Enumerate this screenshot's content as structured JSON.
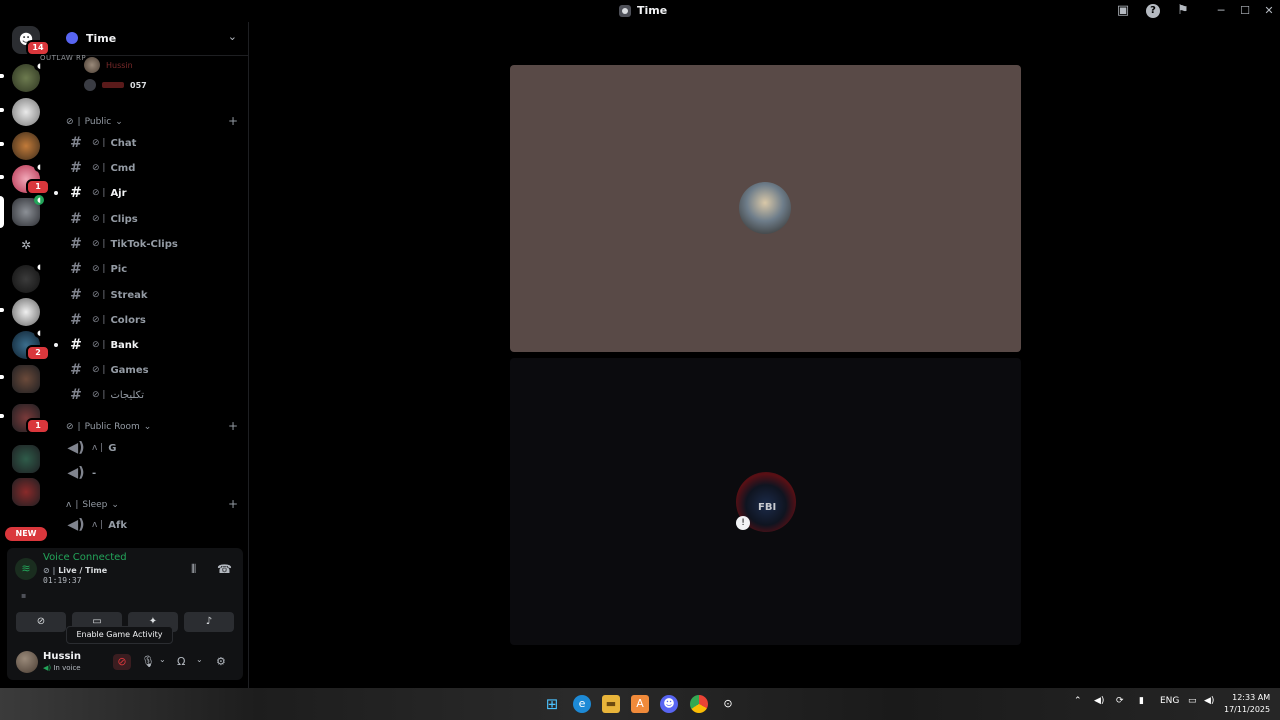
{
  "window": {
    "title": "Time"
  },
  "rail": {
    "home_badge": "14",
    "badges": [
      "1",
      "2",
      "1"
    ],
    "new_label": "NEW"
  },
  "guild": {
    "name": "Time",
    "logo_text": "OUTLAW RP"
  },
  "voice_users": [
    {
      "name": "Hussin"
    },
    {
      "name": "",
      "tag": "057"
    }
  ],
  "categories": {
    "public": "Public",
    "public_room": "Public Room",
    "sleep": "Sleep"
  },
  "channels": [
    {
      "name": "Chat",
      "unread": false
    },
    {
      "name": "Cmd",
      "unread": false
    },
    {
      "name": "Ajr",
      "unread": true
    },
    {
      "name": "Clips",
      "unread": false
    },
    {
      "name": "TikTok-Clips",
      "unread": false
    },
    {
      "name": "Pic",
      "unread": false
    },
    {
      "name": "Streak",
      "unread": false
    },
    {
      "name": "Colors",
      "unread": false
    },
    {
      "name": "Bank",
      "unread": true
    },
    {
      "name": "Games",
      "unread": false
    },
    {
      "name": "تكليجات",
      "unread": false
    }
  ],
  "voice_channels": [
    {
      "name": "G"
    },
    {
      "name": "-"
    }
  ],
  "sleep_channels": [
    {
      "name": "Afk"
    }
  ],
  "voice_panel": {
    "status": "Voice Connected",
    "channel": "Live / Time",
    "timer": "01:19:37",
    "tooltip": "Enable Game Activity"
  },
  "user": {
    "name": "Hussin",
    "status": "In voice"
  },
  "taskbar": {
    "language": "ENG",
    "time": "12:33 AM",
    "date": "17/11/2025"
  },
  "colors": {
    "accent": "#5865f2",
    "voice_green": "#23a55a",
    "badge_red": "#da373c",
    "top_tile": "#594a47",
    "bottom_tile": "#0b0b0e"
  },
  "icons": [
    "discord-icon",
    "inbox-icon",
    "help-icon",
    "hash-icon",
    "speaker-icon",
    "mic-icon",
    "headphones-icon",
    "gear-icon",
    "hangup-icon",
    "camera-off-icon",
    "screen-share-icon",
    "activity-icon",
    "soundboard-icon",
    "windows-icon",
    "edge-icon",
    "explorer-icon",
    "chrome-icon"
  ]
}
